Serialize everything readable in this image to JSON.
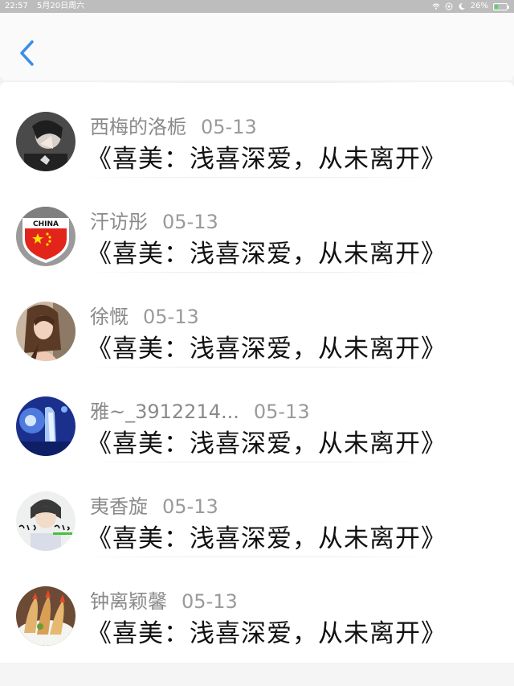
{
  "status_bar": {
    "time": "22:57",
    "date": "5月20日周六",
    "battery_text": "26%",
    "battery_level_percent": 26,
    "icons": [
      "wifi-icon",
      "location-icon",
      "moon-icon",
      "battery-icon"
    ]
  },
  "nav": {
    "back_icon": "chevron-left-icon",
    "accent_color": "#3a8ee6"
  },
  "list": [
    {
      "name": "西梅的洛栀",
      "date": "05-13",
      "title": "《喜美：浅喜深爱，从未离开》",
      "avatar": "avatar-dark-portrait"
    },
    {
      "name": "汗访彤",
      "date": "05-13",
      "title": "《喜美：浅喜深爱，从未离开》",
      "avatar": "avatar-china-badge",
      "avatar_text": "CHINA"
    },
    {
      "name": "徐慨",
      "date": "05-13",
      "title": "《喜美：浅喜深爱，从未离开》",
      "avatar": "avatar-woman-portrait"
    },
    {
      "name": "雅~_3912214...",
      "date": "05-13",
      "title": "《喜美：浅喜深爱，从未离开》",
      "avatar": "avatar-blue-stage"
    },
    {
      "name": "夷香旋",
      "date": "05-13",
      "title": "《喜美：浅喜深爱，从未离开》",
      "avatar": "avatar-boy-handwriting"
    },
    {
      "name": "钟离颖馨",
      "date": "05-13",
      "title": "《喜美：浅喜深爱，从未离开》",
      "avatar": "avatar-fried-shrimp"
    }
  ]
}
